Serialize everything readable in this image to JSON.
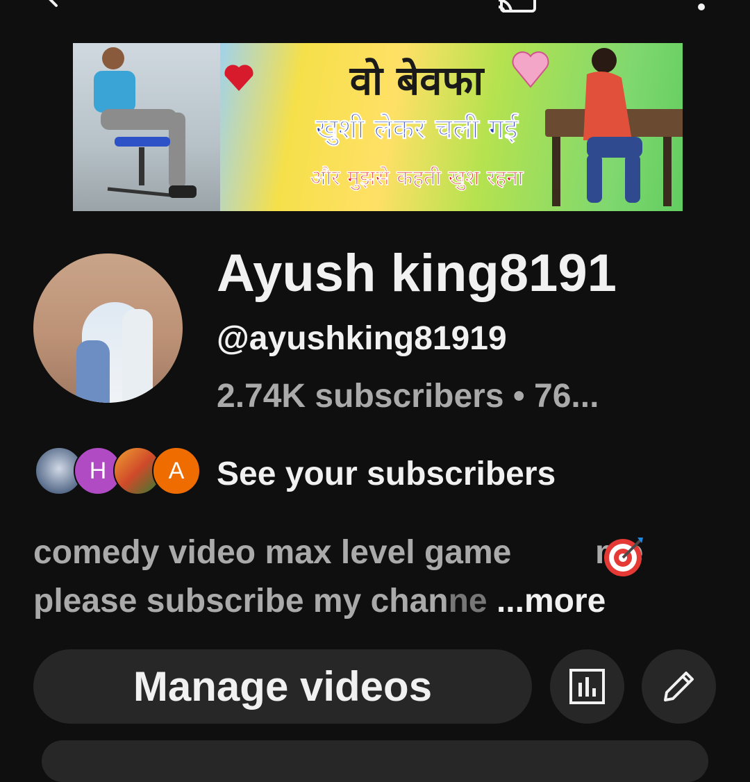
{
  "topbar": {
    "back_icon": "back-arrow-icon",
    "cast_icon": "cast-icon",
    "search_icon": "search-icon",
    "more_icon": "more-vert-icon"
  },
  "banner": {
    "line1": "वो बेवफा",
    "line2": "खुशी लेकर चली गई",
    "line3": "और मुझसे कहती खुश रहना"
  },
  "channel": {
    "name": "Ayush king8191",
    "handle": "@ayushking81919",
    "stats": "2.74K subscribers • 76..."
  },
  "subscribers": {
    "avatars": [
      {
        "letter": "",
        "color": "#5a6e8c"
      },
      {
        "letter": "H",
        "color": "#b04bc4"
      },
      {
        "letter": "",
        "color": "#d04a2a"
      },
      {
        "letter": "A",
        "color": "#ef6c00"
      }
    ],
    "link_label": "See your subscribers"
  },
  "description": {
    "line1_a": "comedy video max level game",
    "line1_b": "me",
    "line2_a": "please subscribe my chan",
    "line2_fade": "ne",
    "more": "...more"
  },
  "actions": {
    "manage_label": "Manage videos",
    "analytics_icon": "analytics-icon",
    "edit_icon": "edit-pencil-icon"
  }
}
